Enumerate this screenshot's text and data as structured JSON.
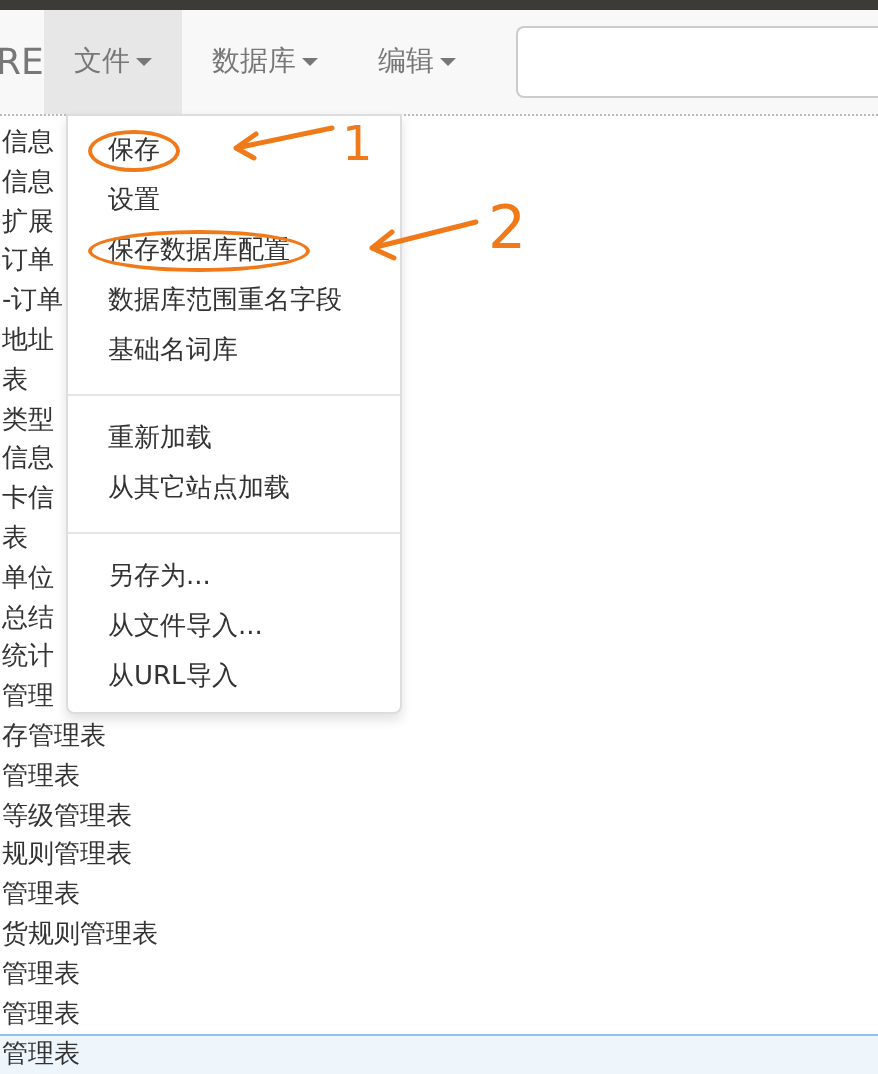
{
  "navbar": {
    "brand": "RE",
    "menus": [
      {
        "label": "文件",
        "selected": true
      },
      {
        "label": "数据库",
        "selected": false
      },
      {
        "label": "编辑",
        "selected": false
      }
    ]
  },
  "list": [
    {
      "label": "信息",
      "selected": false
    },
    {
      "label": "信息",
      "selected": false
    },
    {
      "label": "扩展",
      "selected": false
    },
    {
      "label": "订单",
      "selected": false
    },
    {
      "label": "-订单",
      "selected": false
    },
    {
      "label": "地址",
      "selected": false
    },
    {
      "label": "表",
      "selected": false
    },
    {
      "label": "类型",
      "selected": false
    },
    {
      "label": "信息",
      "selected": false
    },
    {
      "label": "卡信",
      "selected": false
    },
    {
      "label": "表",
      "selected": false
    },
    {
      "label": "单位",
      "selected": false
    },
    {
      "label": "总结",
      "selected": false
    },
    {
      "label": "统计",
      "selected": false
    },
    {
      "label": "管理",
      "selected": false
    },
    {
      "label": "存管理表",
      "selected": false
    },
    {
      "label": "管理表",
      "selected": false
    },
    {
      "label": "等级管理表",
      "selected": false
    },
    {
      "label": "规则管理表",
      "selected": false
    },
    {
      "label": "管理表",
      "selected": false
    },
    {
      "label": "货规则管理表",
      "selected": false
    },
    {
      "label": "管理表",
      "selected": false
    },
    {
      "label": "管理表",
      "selected": false
    },
    {
      "label": "管理表",
      "selected": true
    }
  ],
  "file_menu": [
    {
      "kind": "item",
      "label": "保存",
      "circled": true
    },
    {
      "kind": "item",
      "label": "设置",
      "circled": false
    },
    {
      "kind": "item",
      "label": "保存数据库配置",
      "circled": true
    },
    {
      "kind": "item",
      "label": "数据库范围重名字段",
      "circled": false
    },
    {
      "kind": "item",
      "label": "基础名词库",
      "circled": false
    },
    {
      "kind": "divider"
    },
    {
      "kind": "item",
      "label": "重新加载",
      "circled": false
    },
    {
      "kind": "item",
      "label": "从其它站点加载",
      "circled": false
    },
    {
      "kind": "divider"
    },
    {
      "kind": "item",
      "label": "另存为...",
      "circled": false
    },
    {
      "kind": "item",
      "label": "从文件导入...",
      "circled": false
    },
    {
      "kind": "item",
      "label": "从URL导入",
      "circled": false
    }
  ],
  "annotations": [
    {
      "label": "1"
    },
    {
      "label": "2"
    }
  ]
}
